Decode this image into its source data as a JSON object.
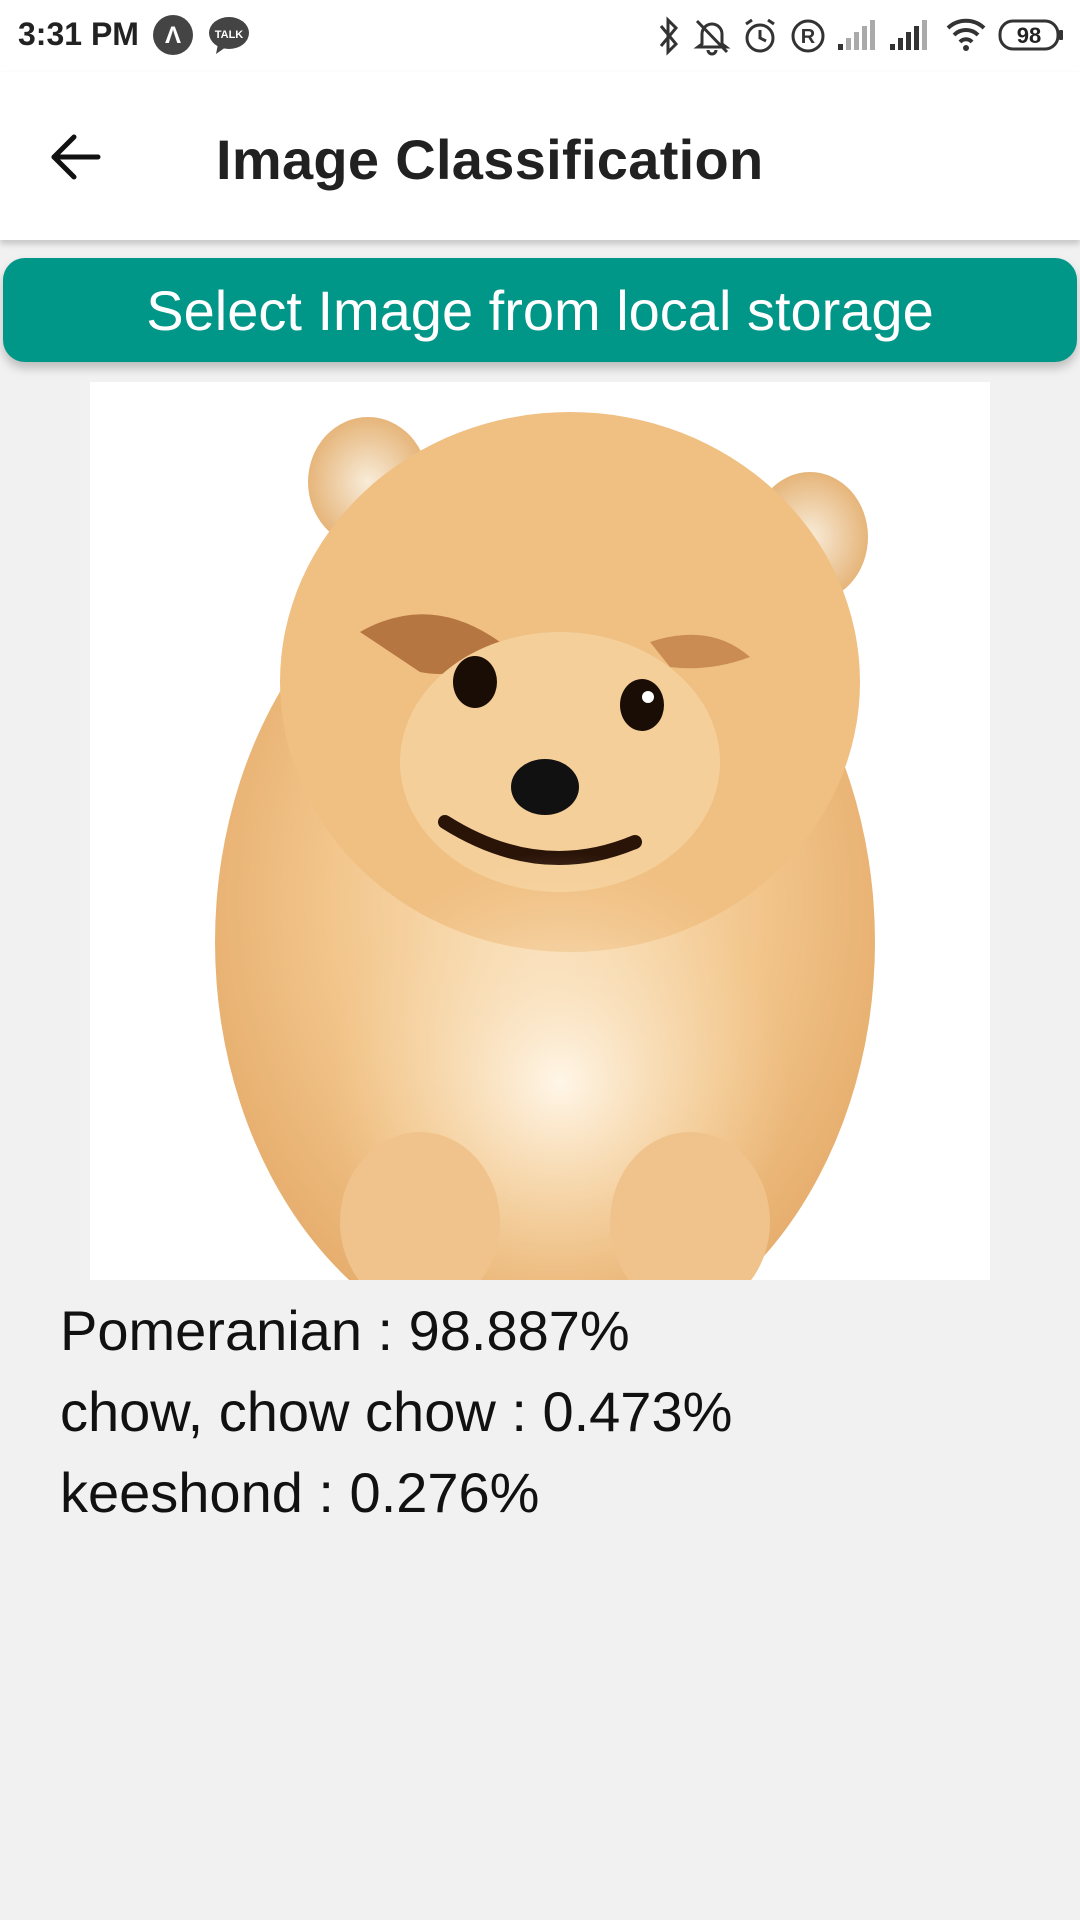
{
  "status_bar": {
    "time": "3:31 PM",
    "app_icon_letter": "Λ",
    "talk_badge": "TALK",
    "battery": "98",
    "icons": [
      "bluetooth-icon",
      "muted-bell-icon",
      "alarm-icon",
      "registered-icon",
      "signal-icon",
      "signal-icon",
      "wifi-icon",
      "battery-icon"
    ]
  },
  "app_bar": {
    "back_icon": "arrow-left-icon",
    "title": "Image Classification"
  },
  "actions": {
    "select_label": "Select Image from local storage",
    "accent_color": "#009688"
  },
  "preview": {
    "subject": "dog-photo"
  },
  "results": [
    "Pomeranian : 98.887%",
    "chow, chow chow : 0.473%",
    "keeshond : 0.276%"
  ]
}
